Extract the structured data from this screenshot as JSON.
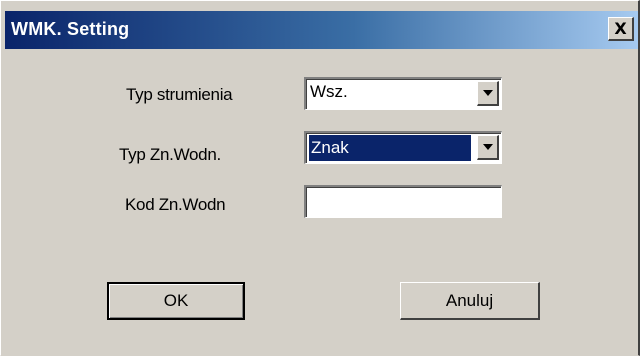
{
  "window": {
    "title": "WMK. Setting",
    "close_label": "X"
  },
  "form": {
    "stream_type": {
      "label": "Typ strumienia",
      "value": "Wsz."
    },
    "watermark_type": {
      "label": "Typ Zn.Wodn.",
      "value": "Znak"
    },
    "watermark_code": {
      "label": "Kod Zn.Wodn",
      "value": ""
    }
  },
  "buttons": {
    "ok_label": "OK",
    "cancel_label": "Anuluj"
  },
  "colors": {
    "face": "#d4d0c8",
    "title_start": "#0a246a",
    "title_end": "#a6caf0",
    "selection": "#0a246a"
  }
}
